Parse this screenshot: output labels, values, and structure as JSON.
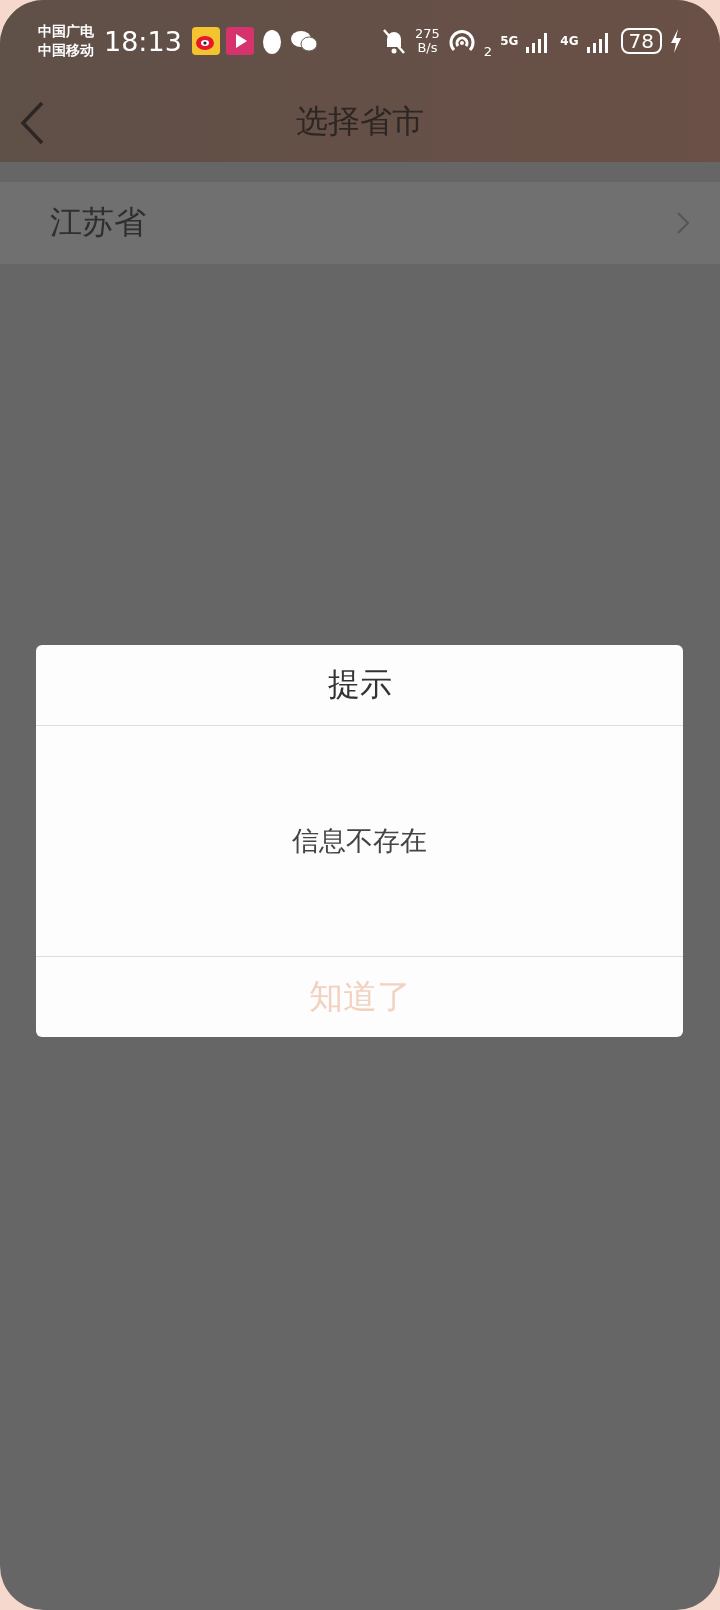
{
  "status_bar": {
    "carriers": [
      "中国广电",
      "中国移动"
    ],
    "time": "18:13",
    "speed_value": "275",
    "speed_unit": "B/s",
    "hotspot_count": "2",
    "sim1": "5G",
    "sim2": "4G",
    "battery": "78"
  },
  "header": {
    "title": "选择省市"
  },
  "list": [
    {
      "label": "江苏省"
    }
  ],
  "dialog": {
    "title": "提示",
    "message": "信息不存在",
    "button": "知道了"
  }
}
